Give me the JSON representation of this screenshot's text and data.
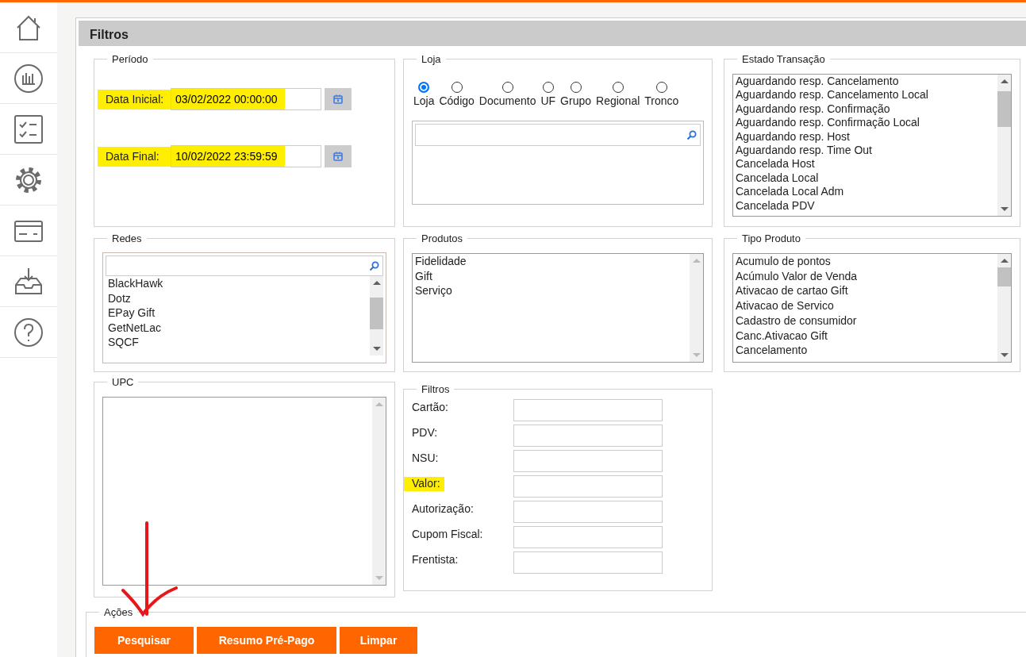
{
  "header": {
    "title": "Filtros"
  },
  "periodo": {
    "legend": "Período",
    "fields": [
      {
        "label": "Data Inicial:",
        "value": "03/02/2022 00:00:00",
        "highlighted": true
      },
      {
        "label": "Data Final:",
        "value": "10/02/2022 23:59:59",
        "highlighted": true
      }
    ]
  },
  "loja": {
    "legend": "Loja",
    "options": [
      {
        "label": "Loja",
        "selected": true
      },
      {
        "label": "Código",
        "selected": false
      },
      {
        "label": "Documento",
        "selected": false
      },
      {
        "label": "UF",
        "selected": false
      },
      {
        "label": "Grupo",
        "selected": false
      },
      {
        "label": "Regional",
        "selected": false
      },
      {
        "label": "Tronco",
        "selected": false
      }
    ]
  },
  "estado_transacao": {
    "legend": "Estado Transação",
    "items": [
      "Aguardando resp. Cancelamento",
      "Aguardando resp. Cancelamento Local",
      "Aguardando resp. Confirmação",
      "Aguardando resp. Confirmação Local",
      "Aguardando resp. Host",
      "Aguardando resp. Time Out",
      "Cancelada Host",
      "Cancelada Local",
      "Cancelada Local Adm",
      "Cancelada PDV"
    ]
  },
  "redes": {
    "legend": "Redes",
    "items": [
      "BlackHawk",
      "Dotz",
      "EPay Gift",
      "GetNetLac",
      "SQCF"
    ]
  },
  "produtos": {
    "legend": "Produtos",
    "items": [
      "Fidelidade",
      "Gift",
      "Serviço"
    ]
  },
  "tipo_produto": {
    "legend": "Tipo Produto",
    "items": [
      "Acumulo de pontos",
      "Acúmulo Valor de Venda",
      "Ativacao de cartao Gift",
      "Ativacao de Servico",
      "Cadastro de consumidor",
      "Canc.Ativacao Gift",
      "Cancelamento"
    ]
  },
  "upc": {
    "legend": "UPC"
  },
  "filtros": {
    "legend": "Filtros",
    "fields": [
      {
        "label": "Cartão:",
        "highlighted": false
      },
      {
        "label": "PDV:",
        "highlighted": false
      },
      {
        "label": "NSU:",
        "highlighted": false
      },
      {
        "label": "Valor:",
        "highlighted": true
      },
      {
        "label": "Autorização:",
        "highlighted": false
      },
      {
        "label": "Cupom Fiscal:",
        "highlighted": false
      },
      {
        "label": "Frentista:",
        "highlighted": false
      }
    ]
  },
  "acoes": {
    "legend": "Ações",
    "buttons": [
      "Pesquisar",
      "Resumo Pré-Pago",
      "Limpar"
    ]
  }
}
